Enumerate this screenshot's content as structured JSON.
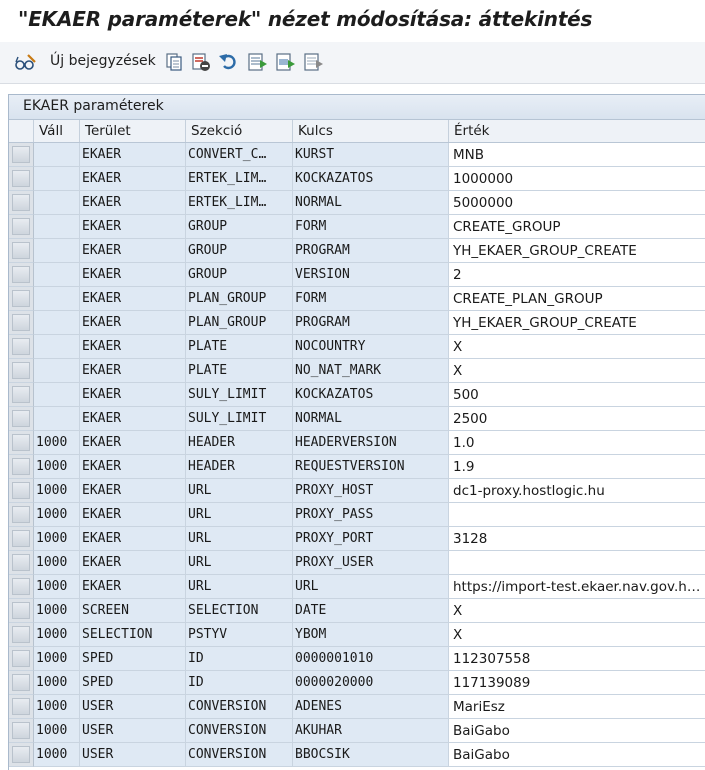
{
  "window": {
    "title": "\"EKAER paraméterek\" nézet módosítása: áttekintés"
  },
  "toolbar": {
    "new_entries_label": "Új bejegyzések",
    "icons": [
      "glasses-edit-icon",
      "copy-icon",
      "delete-icon",
      "undo-icon",
      "select-all-icon",
      "select-block-icon",
      "deselect-all-icon"
    ]
  },
  "panel": {
    "title": "EKAER paraméterek"
  },
  "table": {
    "columns": [
      "Váll",
      "Terület",
      "Szekció",
      "Kulcs",
      "Érték"
    ],
    "rows": [
      {
        "vall": "",
        "terulet": "EKAER",
        "szekcio": "CONVERT_C…",
        "kulcs": "KURST",
        "ertek": "MNB"
      },
      {
        "vall": "",
        "terulet": "EKAER",
        "szekcio": "ERTEK_LIM…",
        "kulcs": "KOCKAZATOS",
        "ertek": "1000000"
      },
      {
        "vall": "",
        "terulet": "EKAER",
        "szekcio": "ERTEK_LIM…",
        "kulcs": "NORMAL",
        "ertek": "5000000"
      },
      {
        "vall": "",
        "terulet": "EKAER",
        "szekcio": "GROUP",
        "kulcs": "FORM",
        "ertek": "CREATE_GROUP"
      },
      {
        "vall": "",
        "terulet": "EKAER",
        "szekcio": "GROUP",
        "kulcs": "PROGRAM",
        "ertek": "YH_EKAER_GROUP_CREATE"
      },
      {
        "vall": "",
        "terulet": "EKAER",
        "szekcio": "GROUP",
        "kulcs": "VERSION",
        "ertek": "2"
      },
      {
        "vall": "",
        "terulet": "EKAER",
        "szekcio": "PLAN_GROUP",
        "kulcs": "FORM",
        "ertek": "CREATE_PLAN_GROUP"
      },
      {
        "vall": "",
        "terulet": "EKAER",
        "szekcio": "PLAN_GROUP",
        "kulcs": "PROGRAM",
        "ertek": "YH_EKAER_GROUP_CREATE"
      },
      {
        "vall": "",
        "terulet": "EKAER",
        "szekcio": "PLATE",
        "kulcs": "NOCOUNTRY",
        "ertek": "X"
      },
      {
        "vall": "",
        "terulet": "EKAER",
        "szekcio": "PLATE",
        "kulcs": "NO_NAT_MARK",
        "ertek": "X"
      },
      {
        "vall": "",
        "terulet": "EKAER",
        "szekcio": "SULY_LIMIT",
        "kulcs": "KOCKAZATOS",
        "ertek": "500"
      },
      {
        "vall": "",
        "terulet": "EKAER",
        "szekcio": "SULY_LIMIT",
        "kulcs": "NORMAL",
        "ertek": "2500"
      },
      {
        "vall": "1000",
        "terulet": "EKAER",
        "szekcio": "HEADER",
        "kulcs": "HEADERVERSION",
        "ertek": "1.0"
      },
      {
        "vall": "1000",
        "terulet": "EKAER",
        "szekcio": "HEADER",
        "kulcs": "REQUESTVERSION",
        "ertek": "1.9"
      },
      {
        "vall": "1000",
        "terulet": "EKAER",
        "szekcio": "URL",
        "kulcs": "PROXY_HOST",
        "ertek": "dc1-proxy.hostlogic.hu"
      },
      {
        "vall": "1000",
        "terulet": "EKAER",
        "szekcio": "URL",
        "kulcs": "PROXY_PASS",
        "ertek": ""
      },
      {
        "vall": "1000",
        "terulet": "EKAER",
        "szekcio": "URL",
        "kulcs": "PROXY_PORT",
        "ertek": "3128"
      },
      {
        "vall": "1000",
        "terulet": "EKAER",
        "szekcio": "URL",
        "kulcs": "PROXY_USER",
        "ertek": ""
      },
      {
        "vall": "1000",
        "terulet": "EKAER",
        "szekcio": "URL",
        "kulcs": "URL",
        "ertek": "https://import-test.ekaer.nav.gov.hu/…"
      },
      {
        "vall": "1000",
        "terulet": "SCREEN",
        "szekcio": "SELECTION",
        "kulcs": "DATE",
        "ertek": "X"
      },
      {
        "vall": "1000",
        "terulet": "SELECTION",
        "szekcio": "PSTYV",
        "kulcs": "YBOM",
        "ertek": "X"
      },
      {
        "vall": "1000",
        "terulet": "SPED",
        "szekcio": "ID",
        "kulcs": "0000001010",
        "ertek": "112307558"
      },
      {
        "vall": "1000",
        "terulet": "SPED",
        "szekcio": "ID",
        "kulcs": "0000020000",
        "ertek": "117139089"
      },
      {
        "vall": "1000",
        "terulet": "USER",
        "szekcio": "CONVERSION",
        "kulcs": "ADENES",
        "ertek": "MariEsz"
      },
      {
        "vall": "1000",
        "terulet": "USER",
        "szekcio": "CONVERSION",
        "kulcs": "AKUHAR",
        "ertek": "BaiGabo"
      },
      {
        "vall": "1000",
        "terulet": "USER",
        "szekcio": "CONVERSION",
        "kulcs": "BBOCSIK",
        "ertek": "BaiGabo"
      }
    ]
  }
}
